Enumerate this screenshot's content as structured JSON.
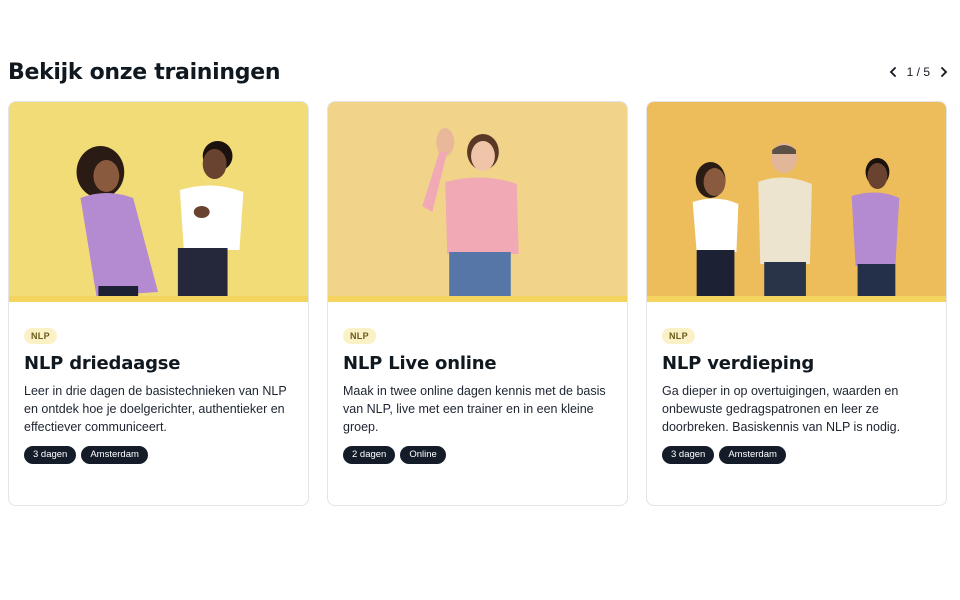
{
  "section": {
    "heading": "Bekijk onze trainingen",
    "pager": {
      "current": "1",
      "separator": "/",
      "total": "5",
      "label": "1 / 5"
    }
  },
  "colors": {
    "accent_strip": "#f4d35e",
    "chip_bg": "#141c2a",
    "tag_bg": "#fbf1c7"
  },
  "cards": [
    {
      "tag": "NLP",
      "title": "NLP driedaagse",
      "description": "Leer in drie dagen de basistechnieken van NLP en ontdek hoe je doelgerichter, authentieker en effectiever communiceert.",
      "chips": [
        "3 dagen",
        "Amsterdam"
      ],
      "photo_bg": "#f2dc78"
    },
    {
      "tag": "NLP",
      "title": "NLP Live online",
      "description": "Maak in twee online dagen kennis met de basis van NLP, live met een trainer en in een kleine groep.",
      "chips": [
        "2 dagen",
        "Online"
      ],
      "photo_bg": "#f1d38a"
    },
    {
      "tag": "NLP",
      "title": "NLP verdieping",
      "description": "Ga dieper in op overtuigingen, waarden en onbewuste gedragspatronen en leer ze doorbreken. Basiskennis van NLP is nodig.",
      "chips": [
        "3 dagen",
        "Amsterdam"
      ],
      "photo_bg": "#edbd5c"
    }
  ]
}
